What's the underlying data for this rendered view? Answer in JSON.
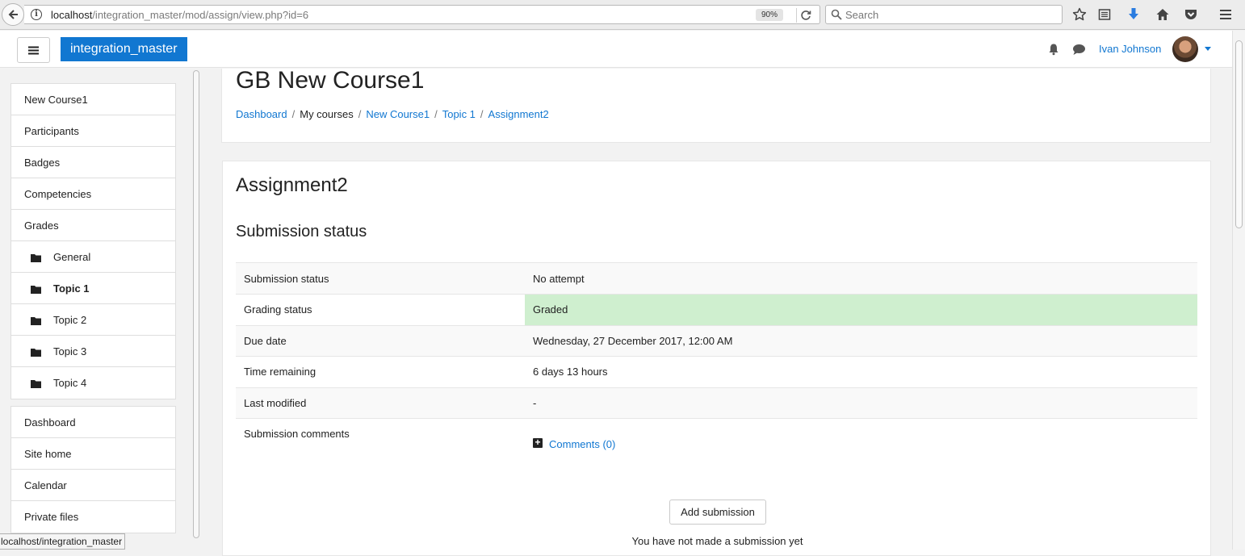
{
  "browser": {
    "url_host": "localhost",
    "url_path": "/integration_master/mod/assign/view.php?id=6",
    "zoom": "90%",
    "search_placeholder": "Search",
    "status_url": "localhost/integration_master"
  },
  "navbar": {
    "site_name": "integration_master",
    "user_name": "Ivan Johnson"
  },
  "drawer": {
    "course_nav": [
      {
        "label": "New Course1",
        "indent": false,
        "bold": false,
        "folder": false
      },
      {
        "label": "Participants",
        "indent": false,
        "bold": false,
        "folder": false
      },
      {
        "label": "Badges",
        "indent": false,
        "bold": false,
        "folder": false
      },
      {
        "label": "Competencies",
        "indent": false,
        "bold": false,
        "folder": false
      },
      {
        "label": "Grades",
        "indent": false,
        "bold": false,
        "folder": false
      },
      {
        "label": "General",
        "indent": true,
        "bold": false,
        "folder": true
      },
      {
        "label": "Topic 1",
        "indent": true,
        "bold": true,
        "folder": true
      },
      {
        "label": "Topic 2",
        "indent": true,
        "bold": false,
        "folder": true
      },
      {
        "label": "Topic 3",
        "indent": true,
        "bold": false,
        "folder": true
      },
      {
        "label": "Topic 4",
        "indent": true,
        "bold": false,
        "folder": true
      }
    ],
    "site_nav": [
      {
        "label": "Dashboard"
      },
      {
        "label": "Site home"
      },
      {
        "label": "Calendar"
      },
      {
        "label": "Private files"
      }
    ]
  },
  "header": {
    "course_title": "GB New Course1",
    "breadcrumb": [
      {
        "label": "Dashboard",
        "link": true
      },
      {
        "label": "My courses",
        "link": false
      },
      {
        "label": "New Course1",
        "link": true
      },
      {
        "label": "Topic 1",
        "link": true
      },
      {
        "label": "Assignment2",
        "link": true
      }
    ]
  },
  "main": {
    "assignment_title": "Assignment2",
    "section_title": "Submission status",
    "rows": [
      {
        "label": "Submission status",
        "value": "No attempt"
      },
      {
        "label": "Grading status",
        "value": "Graded",
        "highlight": "#cfefcf"
      },
      {
        "label": "Due date",
        "value": "Wednesday, 27 December 2017, 12:00 AM"
      },
      {
        "label": "Time remaining",
        "value": "6 days 13 hours"
      },
      {
        "label": "Last modified",
        "value": "-"
      }
    ],
    "comments_label": "Submission comments",
    "comments_link": "Comments (0)",
    "add_submission_button": "Add submission",
    "no_submission_text": "You have not made a submission yet"
  },
  "colors": {
    "brand": "#1177d1",
    "graded_bg": "#cfefcf"
  }
}
